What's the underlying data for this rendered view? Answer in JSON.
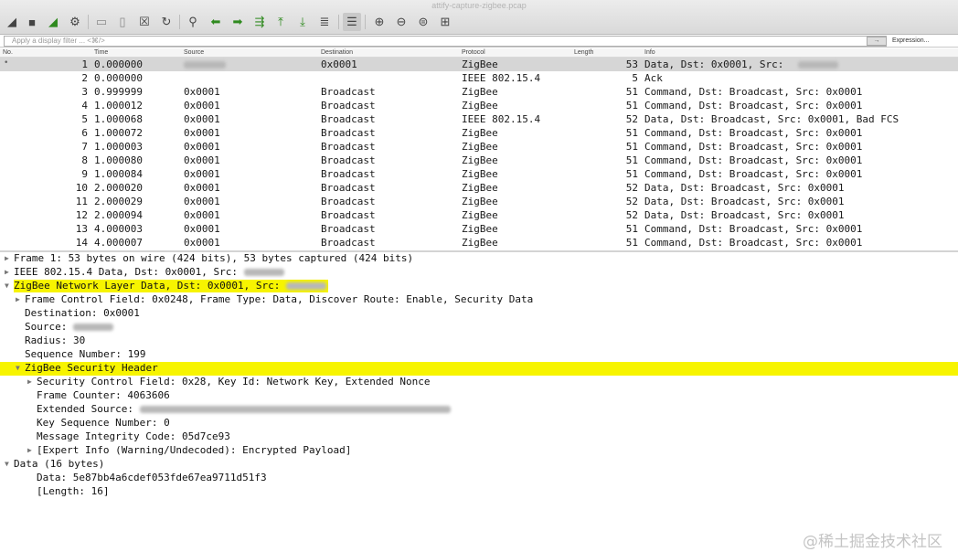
{
  "window": {
    "title": "attify-capture-zigbee.pcap"
  },
  "filter": {
    "placeholder": "Apply a display filter ... <⌘/>",
    "expression_label": "Expression..."
  },
  "columns": [
    "No.",
    "Time",
    "Source",
    "Destination",
    "Protocol",
    "Length",
    "Info"
  ],
  "packets": [
    {
      "no": "1",
      "time": "0.000000",
      "src": "",
      "dst": "0x0001",
      "proto": "ZigBee",
      "len": "53",
      "info": "Data, Dst: 0x0001, Src: ",
      "src_redacted": true,
      "info_redacted": true,
      "selected": true
    },
    {
      "no": "2",
      "time": "0.000000",
      "src": "",
      "dst": "",
      "proto": "IEEE 802.15.4",
      "len": "5",
      "info": "Ack"
    },
    {
      "no": "3",
      "time": "0.999999",
      "src": "0x0001",
      "dst": "Broadcast",
      "proto": "ZigBee",
      "len": "51",
      "info": "Command, Dst: Broadcast, Src: 0x0001"
    },
    {
      "no": "4",
      "time": "1.000012",
      "src": "0x0001",
      "dst": "Broadcast",
      "proto": "ZigBee",
      "len": "51",
      "info": "Command, Dst: Broadcast, Src: 0x0001"
    },
    {
      "no": "5",
      "time": "1.000068",
      "src": "0x0001",
      "dst": "Broadcast",
      "proto": "IEEE 802.15.4",
      "len": "52",
      "info": "Data, Dst: Broadcast, Src: 0x0001, Bad FCS"
    },
    {
      "no": "6",
      "time": "1.000072",
      "src": "0x0001",
      "dst": "Broadcast",
      "proto": "ZigBee",
      "len": "51",
      "info": "Command, Dst: Broadcast, Src: 0x0001"
    },
    {
      "no": "7",
      "time": "1.000003",
      "src": "0x0001",
      "dst": "Broadcast",
      "proto": "ZigBee",
      "len": "51",
      "info": "Command, Dst: Broadcast, Src: 0x0001"
    },
    {
      "no": "8",
      "time": "1.000080",
      "src": "0x0001",
      "dst": "Broadcast",
      "proto": "ZigBee",
      "len": "51",
      "info": "Command, Dst: Broadcast, Src: 0x0001"
    },
    {
      "no": "9",
      "time": "1.000084",
      "src": "0x0001",
      "dst": "Broadcast",
      "proto": "ZigBee",
      "len": "51",
      "info": "Command, Dst: Broadcast, Src: 0x0001"
    },
    {
      "no": "10",
      "time": "2.000020",
      "src": "0x0001",
      "dst": "Broadcast",
      "proto": "ZigBee",
      "len": "52",
      "info": "Data, Dst: Broadcast, Src: 0x0001"
    },
    {
      "no": "11",
      "time": "2.000029",
      "src": "0x0001",
      "dst": "Broadcast",
      "proto": "ZigBee",
      "len": "52",
      "info": "Data, Dst: Broadcast, Src: 0x0001"
    },
    {
      "no": "12",
      "time": "2.000094",
      "src": "0x0001",
      "dst": "Broadcast",
      "proto": "ZigBee",
      "len": "52",
      "info": "Data, Dst: Broadcast, Src: 0x0001"
    },
    {
      "no": "13",
      "time": "4.000003",
      "src": "0x0001",
      "dst": "Broadcast",
      "proto": "ZigBee",
      "len": "51",
      "info": "Command, Dst: Broadcast, Src: 0x0001"
    },
    {
      "no": "14",
      "time": "4.000007",
      "src": "0x0001",
      "dst": "Broadcast",
      "proto": "ZigBee",
      "len": "51",
      "info": "Command, Dst: Broadcast, Src: 0x0001"
    }
  ],
  "details": [
    {
      "text": "Frame 1: 53 bytes on wire (424 bits), 53 bytes captured (424 bits)",
      "level": 0,
      "toggle": "collapsed"
    },
    {
      "text": "IEEE 802.15.4 Data, Dst: 0x0001, Src: ",
      "level": 0,
      "toggle": "collapsed",
      "redacted": true
    },
    {
      "text": "ZigBee Network Layer Data, Dst: 0x0001, Src: ",
      "level": 0,
      "toggle": "expanded",
      "redacted": true,
      "highlight": "text"
    },
    {
      "text": "Frame Control Field: 0x0248, Frame Type: Data, Discover Route: Enable, Security Data",
      "level": 1,
      "toggle": "collapsed"
    },
    {
      "text": "Destination: 0x0001",
      "level": 1
    },
    {
      "text": "Source: ",
      "level": 1,
      "redacted": true
    },
    {
      "text": "Radius: 30",
      "level": 1
    },
    {
      "text": "Sequence Number: 199",
      "level": 1
    },
    {
      "text": "ZigBee Security Header",
      "level": 1,
      "toggle": "expanded",
      "highlight": "full"
    },
    {
      "text": "Security Control Field: 0x28, Key Id: Network Key, Extended Nonce",
      "level": 2,
      "toggle": "collapsed"
    },
    {
      "text": "Frame Counter: 4063606",
      "level": 2
    },
    {
      "text": "Extended Source: ",
      "level": 2,
      "redacted": true,
      "redacted_long": true
    },
    {
      "text": "Key Sequence Number: 0",
      "level": 2
    },
    {
      "text": "Message Integrity Code: 05d7ce93",
      "level": 2
    },
    {
      "text": "[Expert Info (Warning/Undecoded): Encrypted Payload]",
      "level": 2,
      "toggle": "collapsed"
    },
    {
      "text": "Data (16 bytes)",
      "level": 0,
      "toggle": "expanded"
    },
    {
      "text": "Data: 5e87bb4a6cdef053fde67ea9711d51f3",
      "level": 2
    },
    {
      "text": "[Length: 16]",
      "level": 2
    }
  ],
  "watermark": "@稀土掘金技术社区",
  "icons": [
    "shark-fin-icon",
    "stop-icon",
    "restart-icon",
    "options-icon",
    "open-folder-icon",
    "file-icon",
    "close-file-icon",
    "reload-icon",
    "find-icon",
    "back-icon",
    "forward-icon",
    "go-to-packet-icon",
    "first-packet-icon",
    "last-packet-icon",
    "autoscroll-icon",
    "colorize-icon",
    "zoom-in-icon",
    "zoom-out-icon",
    "zoom-reset-icon",
    "resize-columns-icon"
  ]
}
